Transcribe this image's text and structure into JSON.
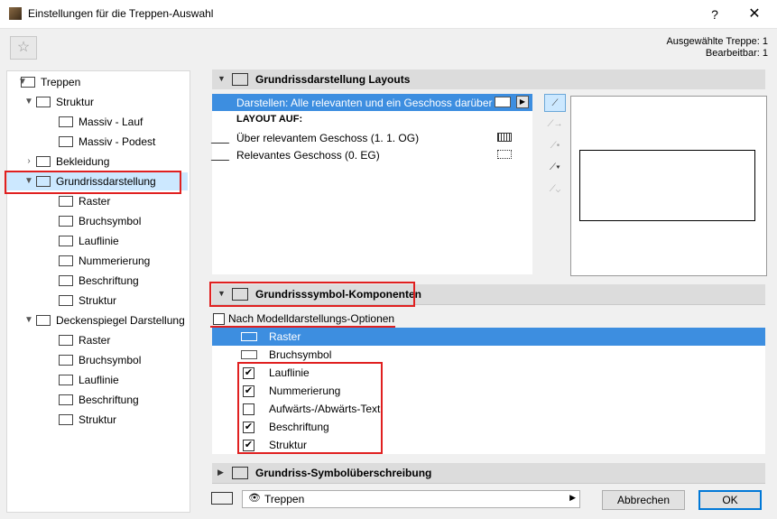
{
  "window": {
    "title": "Einstellungen für die Treppen-Auswahl",
    "help": "?",
    "close": "✕"
  },
  "favorite_icon": "☆",
  "selection_info": {
    "line1": "Ausgewählte Treppe: 1",
    "line2": "Bearbeitbar: 1"
  },
  "tree": {
    "items": [
      {
        "label": "Treppen",
        "icon": "stairs-icon"
      },
      {
        "label": "Struktur",
        "icon": "structure-icon"
      },
      {
        "label": "Massiv - Lauf",
        "icon": "flight-icon"
      },
      {
        "label": "Massiv - Podest",
        "icon": "landing-icon"
      },
      {
        "label": "Bekleidung",
        "icon": "finish-icon"
      },
      {
        "label": "Grundrissdarstellung",
        "icon": "floorplan-icon"
      },
      {
        "label": "Raster",
        "icon": "grid-icon"
      },
      {
        "label": "Bruchsymbol",
        "icon": "break-icon"
      },
      {
        "label": "Lauflinie",
        "icon": "walkline-icon"
      },
      {
        "label": "Nummerierung",
        "icon": "numbering-icon"
      },
      {
        "label": "Beschriftung",
        "icon": "label-icon"
      },
      {
        "label": "Struktur",
        "icon": "structure-icon"
      },
      {
        "label": "Deckenspiegel Darstellung",
        "icon": "ceiling-icon"
      },
      {
        "label": "Raster",
        "icon": "grid-icon"
      },
      {
        "label": "Bruchsymbol",
        "icon": "break-icon"
      },
      {
        "label": "Lauflinie",
        "icon": "walkline-icon"
      },
      {
        "label": "Beschriftung",
        "icon": "label-icon"
      },
      {
        "label": "Struktur",
        "icon": "structure-icon"
      }
    ]
  },
  "layouts_panel": {
    "title": "Grundrissdarstellung Layouts",
    "selected_row": "Darstellen: Alle relevanten und ein Geschoss darüber",
    "section_header": "LAYOUT AUF:",
    "rows": [
      {
        "label": "Über relevantem Geschoss (1. 1. OG)"
      },
      {
        "label": "Relevantes Geschoss (0. EG)"
      }
    ]
  },
  "components_panel": {
    "title": "Grundrisssymbol-Komponenten",
    "model_option": "Nach Modelldarstellungs-Optionen",
    "items": [
      {
        "label": "Raster",
        "checked": null
      },
      {
        "label": "Bruchsymbol",
        "checked": null
      },
      {
        "label": "Lauflinie",
        "checked": "✔"
      },
      {
        "label": "Nummerierung",
        "checked": "✔"
      },
      {
        "label": "Aufwärts-/Abwärts-Text",
        "checked": ""
      },
      {
        "label": "Beschriftung",
        "checked": "✔"
      },
      {
        "label": "Struktur",
        "checked": "✔"
      }
    ]
  },
  "override_panel": {
    "title": "Grundriss-Symbolüberschreibung"
  },
  "bottom": {
    "view_select": "Treppen",
    "cancel": "Abbrechen",
    "ok": "OK"
  },
  "colors": {
    "selection_blue": "#3d8ee0",
    "tree_selection": "#cce8ff",
    "highlight_red": "#e02020"
  }
}
